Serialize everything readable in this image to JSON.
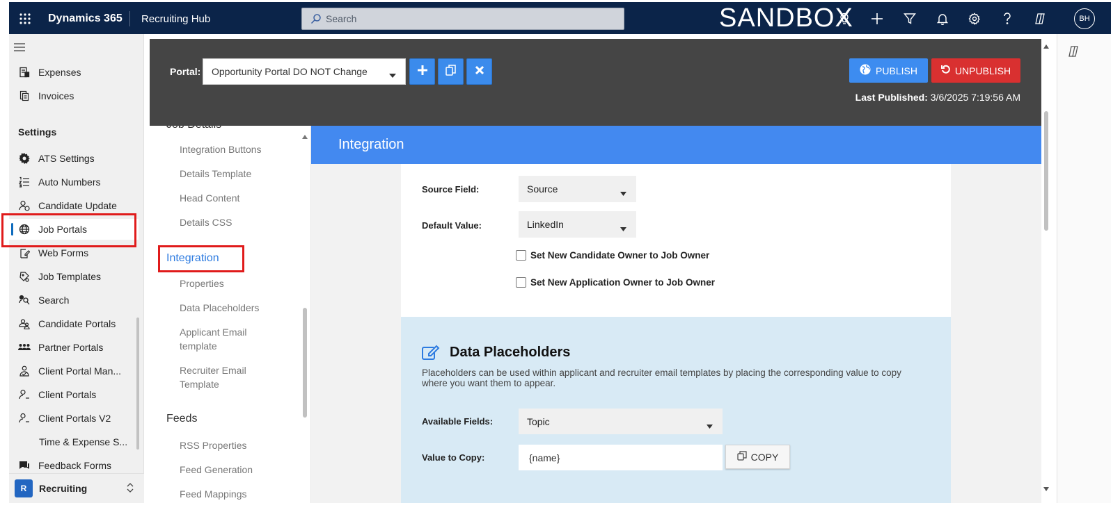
{
  "topbar": {
    "app_name": "Dynamics 365",
    "hub_name": "Recruiting Hub",
    "search_placeholder": "Search",
    "environment": "SANDBOX",
    "avatar_initials": "BH",
    "icons": [
      "lightbulb-icon",
      "plus-icon",
      "filter-icon",
      "bell-icon",
      "settings-icon",
      "help-icon",
      "copilot-icon"
    ]
  },
  "leftnav": {
    "items_top": [
      {
        "label": "Expenses",
        "icon": "expenses-icon"
      },
      {
        "label": "Invoices",
        "icon": "invoices-icon"
      }
    ],
    "settings_title": "Settings",
    "settings_items": [
      {
        "label": "ATS Settings",
        "icon": "gear-icon"
      },
      {
        "label": "Auto Numbers",
        "icon": "numbered-list-icon"
      },
      {
        "label": "Candidate Update",
        "icon": "person-sync-icon"
      },
      {
        "label": "Job Portals",
        "icon": "globe-icon",
        "selected": true
      },
      {
        "label": "Web Forms",
        "icon": "form-icon"
      },
      {
        "label": "Job Templates",
        "icon": "template-icon"
      },
      {
        "label": "Search",
        "icon": "search-people-icon"
      },
      {
        "label": "Candidate Portals",
        "icon": "people-icon"
      },
      {
        "label": "Partner Portals",
        "icon": "group-icon"
      },
      {
        "label": "Client Portal Man...",
        "icon": "person-manage-icon"
      },
      {
        "label": "Client Portals",
        "icon": "person-icon"
      },
      {
        "label": "Client Portals V2",
        "icon": "person-icon"
      },
      {
        "label": "Time & Expense S...",
        "icon": ""
      },
      {
        "label": "Feedback Forms",
        "icon": "feedback-icon"
      }
    ],
    "area": {
      "badge": "R",
      "label": "Recruiting"
    }
  },
  "portal_bar": {
    "label": "Portal:",
    "selected_portal": "Opportunity Portal DO NOT Change",
    "publish_label": "PUBLISH",
    "unpublish_label": "UNPUBLISH",
    "last_published_label": "Last Published:",
    "last_published_value": "3/6/2025 7:19:56 AM",
    "colors": {
      "publish": "#3d8cf0",
      "unpublish": "#d93030",
      "bar": "#454545"
    }
  },
  "inner_nav": {
    "partial_heading": "Job Details",
    "job_details_items": [
      "Integration Buttons",
      "Details Template",
      "Head Content",
      "Details CSS"
    ],
    "active_heading": "Integration",
    "integration_items": [
      "Properties",
      "Data Placeholders",
      "Applicant Email template",
      "Recruiter Email Template"
    ],
    "feeds_heading": "Feeds",
    "feeds_items": [
      "RSS Properties",
      "Feed Generation",
      "Feed Mappings"
    ]
  },
  "content": {
    "section_title": "Integration",
    "source_field_label": "Source Field:",
    "source_field_value": "Source",
    "default_value_label": "Default Value:",
    "default_value_value": "LinkedIn",
    "checkbox_owner_candidate": "Set New Candidate Owner to Job Owner",
    "checkbox_owner_application": "Set New Application Owner to Job Owner",
    "placeholders": {
      "title": "Data Placeholders",
      "description": "Placeholders can be used within applicant and recruiter email templates by placing the corresponding value to copy where you want them to appear.",
      "available_fields_label": "Available Fields:",
      "available_fields_value": "Topic",
      "value_to_copy_label": "Value to Copy:",
      "value_to_copy_value": "{name}",
      "copy_label": "COPY"
    },
    "colors": {
      "header": "#4389f0",
      "panel": "#d8eaf5"
    }
  }
}
